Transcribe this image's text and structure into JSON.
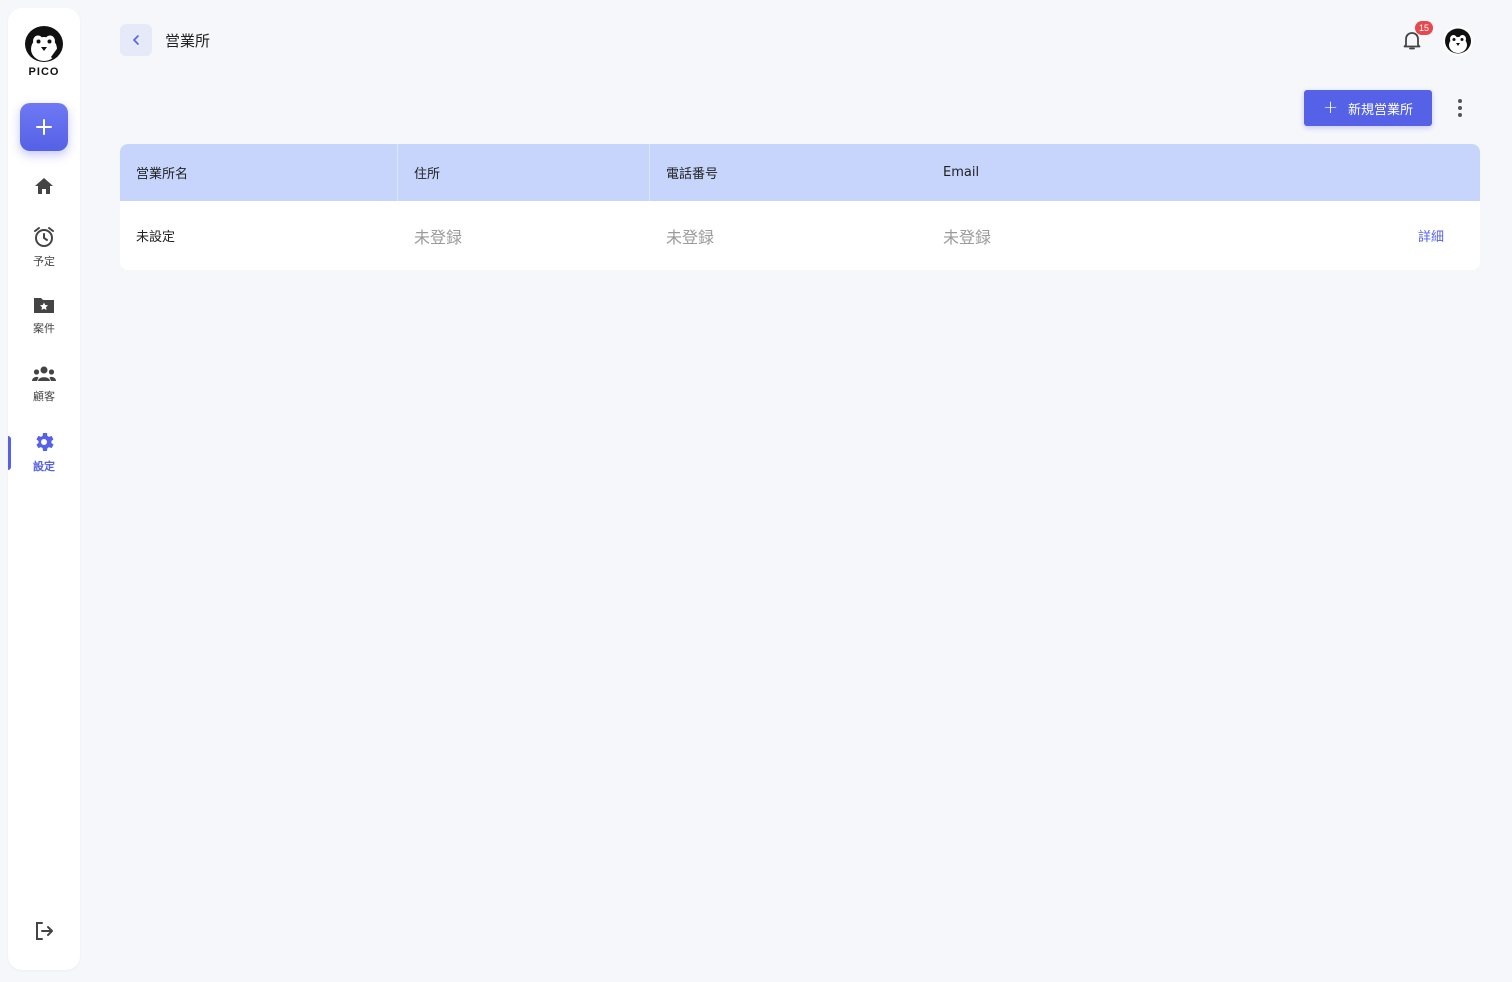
{
  "sidebar": {
    "logo_text": "PICO",
    "items": [
      {
        "name": "home",
        "label": ""
      },
      {
        "name": "schedule",
        "label": "予定"
      },
      {
        "name": "projects",
        "label": "案件"
      },
      {
        "name": "customers",
        "label": "顧客"
      },
      {
        "name": "settings",
        "label": "設定"
      }
    ]
  },
  "header": {
    "title": "営業所",
    "notification_count": "15"
  },
  "toolbar": {
    "new_button_label": "新規営業所"
  },
  "table": {
    "columns": [
      "営業所名",
      "住所",
      "電話番号",
      "Email"
    ],
    "rows": [
      {
        "name": "未設定",
        "address": "未登録",
        "phone": "未登録",
        "email": "未登録",
        "action": "詳細"
      }
    ]
  },
  "colors": {
    "accent": "#5561e6",
    "header_row": "#c7d4fb",
    "badge": "#e5484d",
    "background": "#f6f7fb"
  },
  "icons": [
    "penguin-logo-icon",
    "plus-icon",
    "home-icon",
    "alarm-clock-icon",
    "folder-star-icon",
    "group-icon",
    "gear-icon",
    "logout-icon",
    "chevron-left-icon",
    "bell-icon",
    "kebab-menu-icon"
  ]
}
